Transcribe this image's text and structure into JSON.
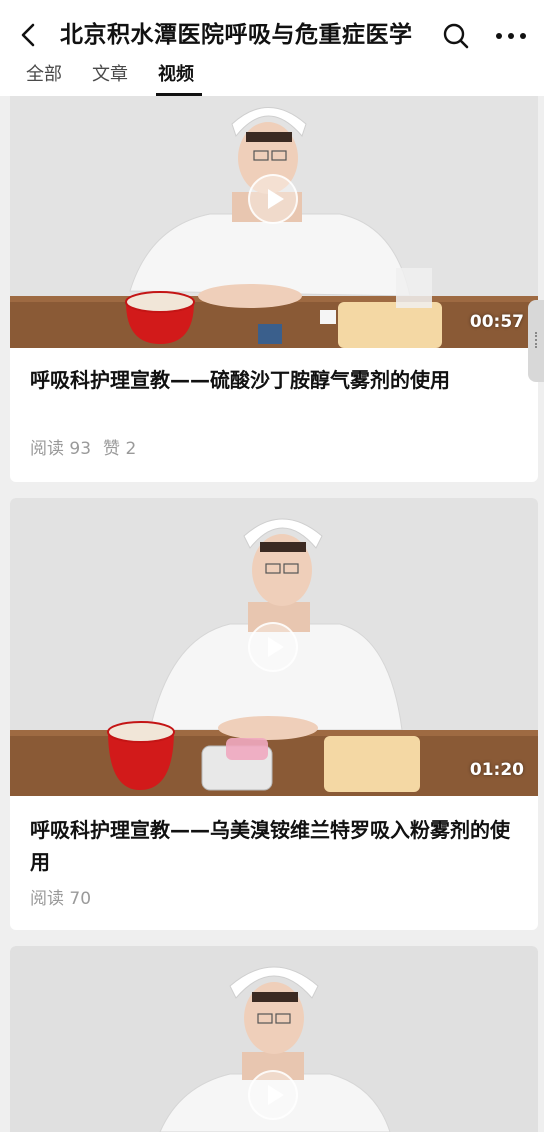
{
  "header": {
    "title": "北京积水潭医院呼吸与危重症医学",
    "back_icon": "chevron-left-icon",
    "search_icon": "search-icon",
    "more_icon": "more-dots-icon",
    "tabs": [
      {
        "label": "全部"
      },
      {
        "label": "文章"
      },
      {
        "label": "视频",
        "active": true
      }
    ]
  },
  "videos": [
    {
      "duration": "00:57",
      "title": "呼吸科护理宣教——硫酸沙丁胺醇气雾剂的使用",
      "reads": "阅读 93",
      "likes": "赞 2"
    },
    {
      "duration": "01:20",
      "title": "呼吸科护理宣教——乌美溴铵维兰特罗吸入粉雾剂的使用",
      "reads": "阅读 70"
    },
    {
      "duration": ""
    }
  ],
  "colors": {
    "background": "#efefef",
    "card": "#ffffff",
    "meta_text": "#9a9a9a",
    "table": "#8a5a36",
    "cup": "#d21a1a"
  }
}
